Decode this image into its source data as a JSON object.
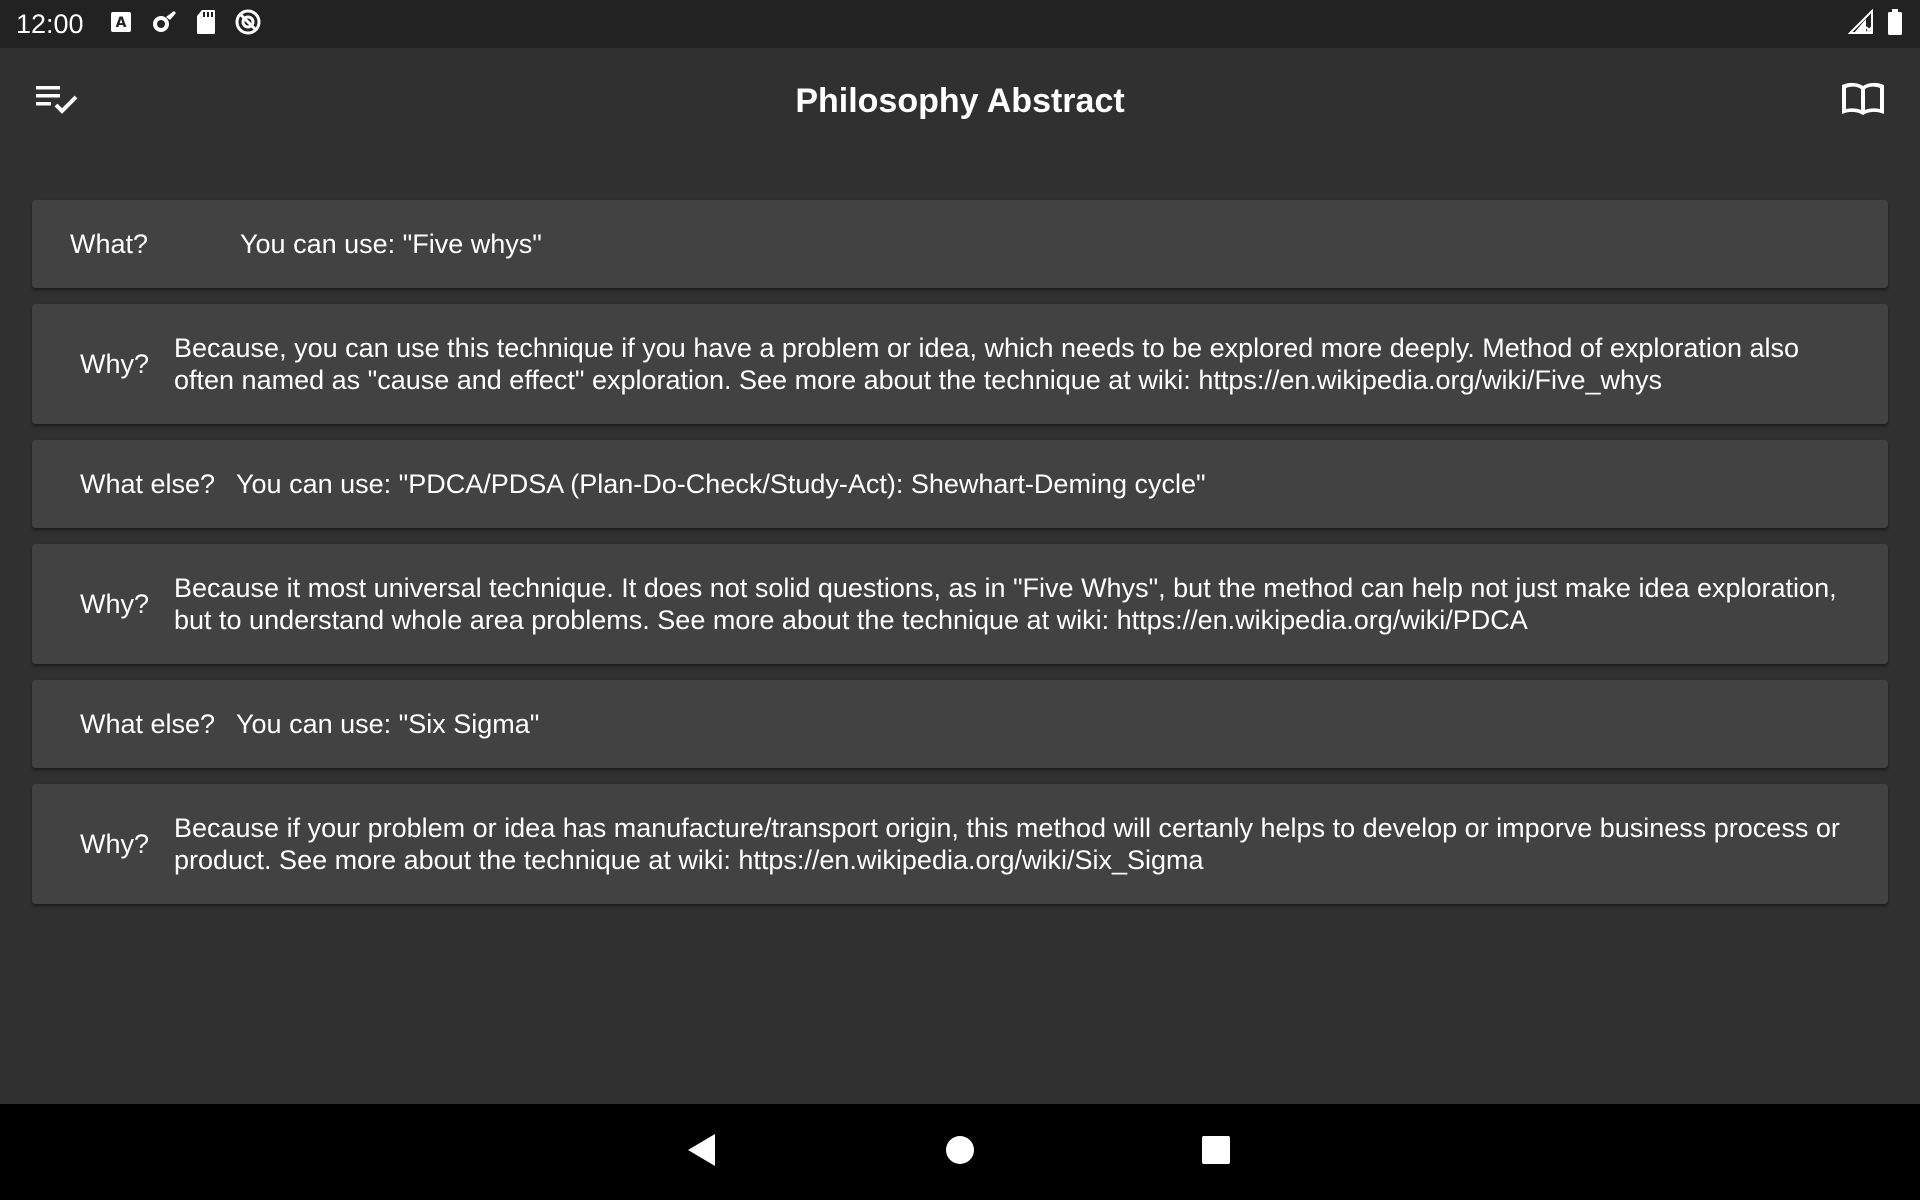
{
  "status_bar": {
    "time": "12:00",
    "left_icons": [
      "font-a-icon",
      "settings-gear-icon",
      "sd-card-icon",
      "sync-circle-icon"
    ],
    "right_icons": [
      "signal-icon",
      "battery-icon"
    ]
  },
  "app_bar": {
    "title": "Philosophy Abstract",
    "left_icon": "playlist-check-icon",
    "right_icon": "book-open-icon"
  },
  "cards": [
    {
      "label": "What?",
      "text": "You can use: \"Five whys\""
    },
    {
      "label": "Why?",
      "text": "Because, you can use this technique if you have a problem or idea, which needs to be explored more deeply. Method of exploration also often named as \"cause and effect\" exploration. See more about the technique at wiki: https://en.wikipedia.org/wiki/Five_whys"
    },
    {
      "label": "What else?",
      "text": "You can use: \"PDCA/PDSA (Plan-Do-Check/Study-Act): Shewhart-Deming cycle\""
    },
    {
      "label": "Why?",
      "text": "Because it most universal technique. It does not solid questions, as in \"Five Whys\", but the method can help not just make idea exploration, but to understand whole area problems. See more about the technique at wiki:  https://en.wikipedia.org/wiki/PDCA"
    },
    {
      "label": "What else?",
      "text": "You can use: \"Six Sigma\""
    },
    {
      "label": "Why?",
      "text": "Because if your problem or idea has manufacture/transport origin, this method will certanly helps to develop or imporve business process or product. See more about the technique at wiki:  https://en.wikipedia.org/wiki/Six_Sigma"
    }
  ],
  "nav_bar": {
    "icons": [
      "back-icon",
      "home-icon",
      "recents-icon"
    ]
  },
  "colors": {
    "background": "#303030",
    "card": "#424242",
    "status_bar": "#222222",
    "nav_bar": "#000000",
    "text": "#ffffff"
  }
}
